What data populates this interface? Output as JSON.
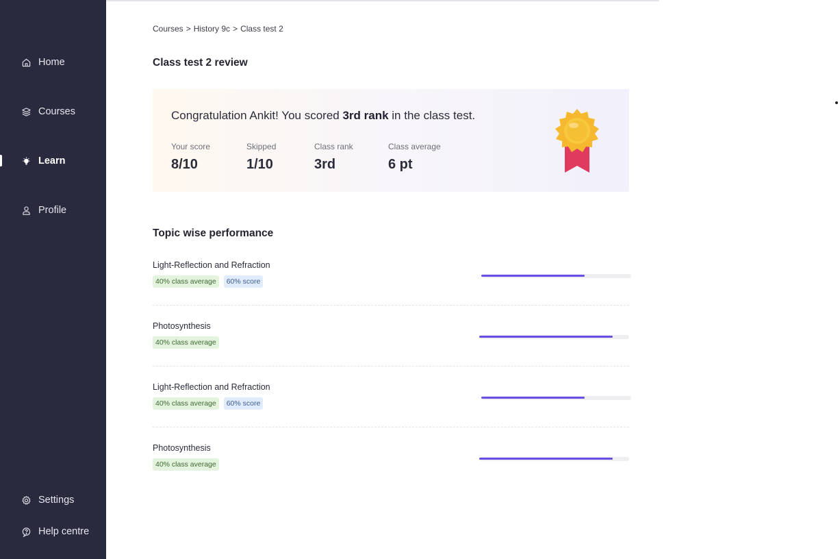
{
  "sidebar": {
    "items": [
      {
        "label": "Home",
        "icon": "home-icon"
      },
      {
        "label": "Courses",
        "icon": "layers-icon"
      },
      {
        "label": "Learn",
        "icon": "lightbulb-icon",
        "active": true
      },
      {
        "label": "Profile",
        "icon": "user-icon"
      }
    ],
    "bottom_items": [
      {
        "label": "Settings",
        "icon": "gear-icon"
      },
      {
        "label": "Help centre",
        "icon": "help-icon"
      }
    ]
  },
  "breadcrumb": {
    "items": [
      "Courses",
      "History 9c",
      "Class test 2"
    ],
    "separator": ">"
  },
  "page_title": "Class test 2 review",
  "result": {
    "congrats_prefix": "Congratulation Ankit! You scored ",
    "congrats_rank": "3rd rank",
    "congrats_suffix": " in the class test.",
    "stats": [
      {
        "label": "Your score",
        "value": "8/10"
      },
      {
        "label": "Skipped",
        "value": "1/10"
      },
      {
        "label": "Class rank",
        "value": "3rd"
      },
      {
        "label": "Class average",
        "value": "6 pt"
      }
    ],
    "badge_icon": "medal-icon"
  },
  "topics_section": {
    "title": "Topic wise performance",
    "topics": [
      {
        "name": "Light-Reflection and Refraction",
        "avg_tag": "40% class average",
        "score_tag": "60% score",
        "progress": 0.69
      },
      {
        "name": "Photosynthesis",
        "avg_tag": "40% class average",
        "progress": 0.89
      },
      {
        "name": "Light-Reflection and Refraction",
        "avg_tag": "40% class average",
        "score_tag": "60% score",
        "progress": 0.69
      },
      {
        "name": "Photosynthesis",
        "avg_tag": "40% class average",
        "progress": 0.89
      }
    ]
  },
  "colors": {
    "sidebar_bg": "#292a3e",
    "accent": "#6a4de6",
    "tag_green_bg": "#e3f3dd",
    "tag_blue_bg": "#e0ebfb"
  }
}
